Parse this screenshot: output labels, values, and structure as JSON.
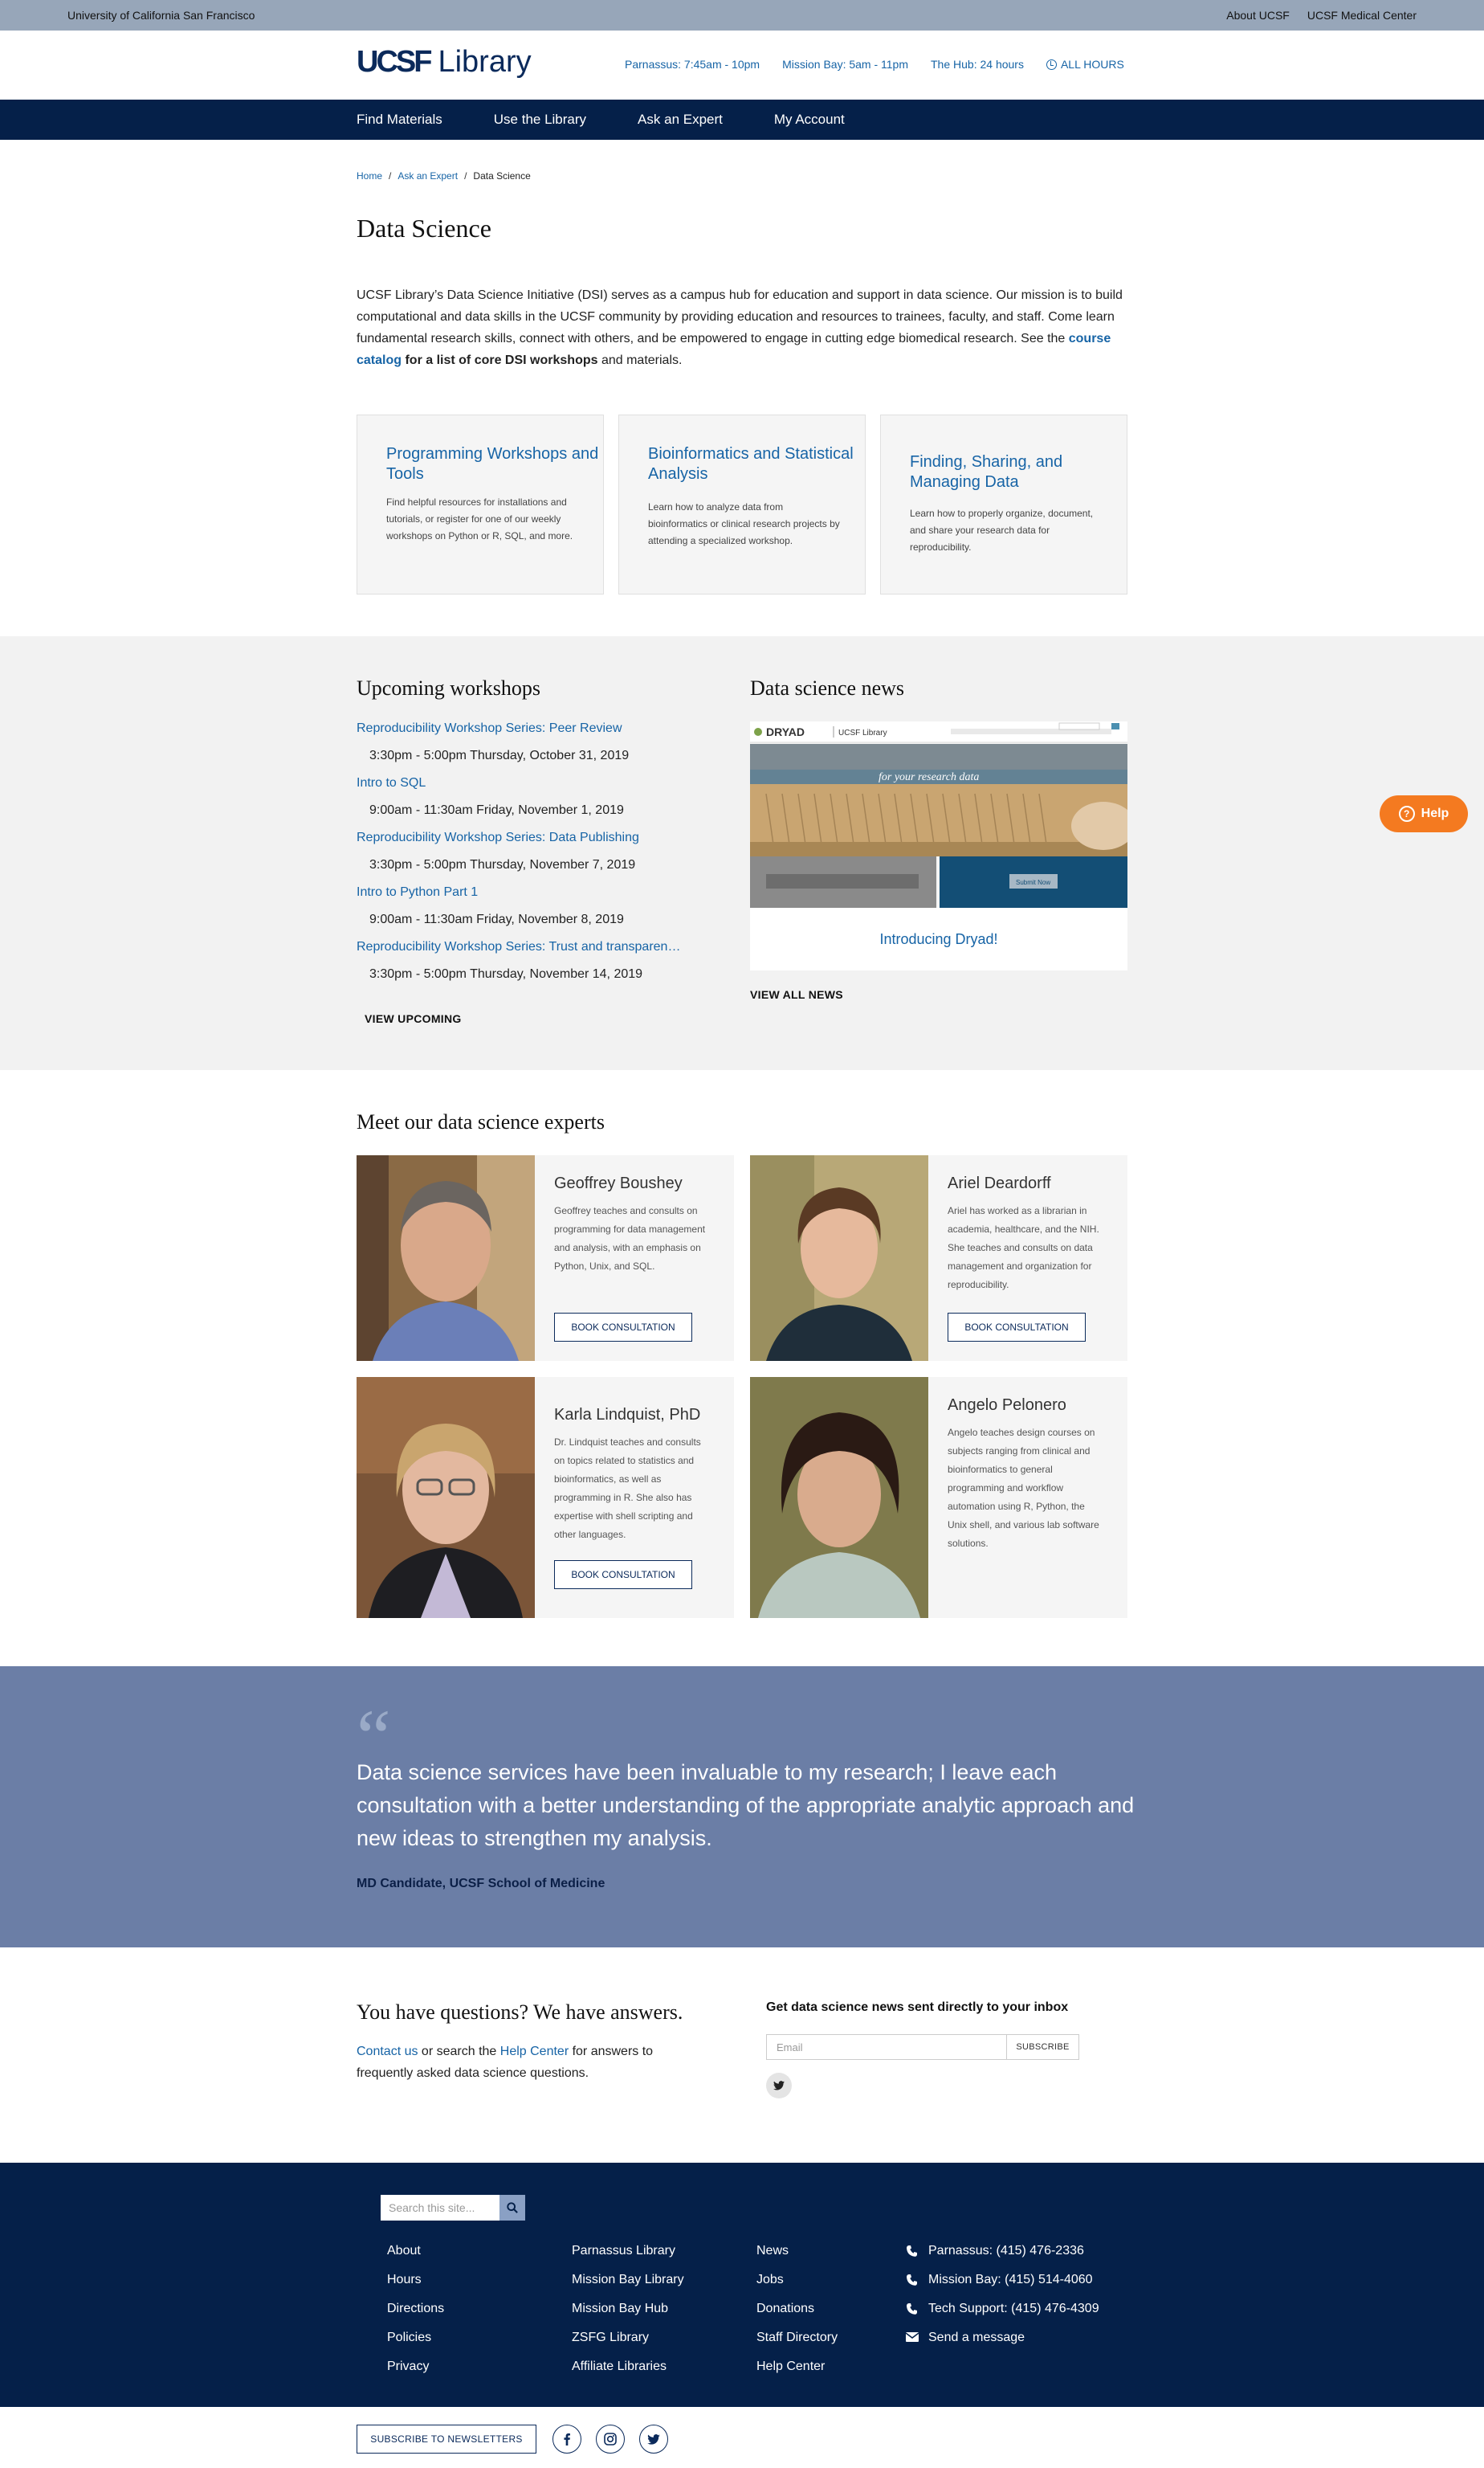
{
  "utility": {
    "org": "University of California San Francisco",
    "links": [
      "About UCSF",
      "UCSF Medical Center"
    ]
  },
  "header": {
    "logo_mark": "UCSF",
    "logo_text": "Library",
    "hours": [
      "Parnassus: 7:45am - 10pm",
      "Mission Bay: 5am - 11pm",
      "The Hub: 24 hours"
    ],
    "all_hours": "ALL HOURS"
  },
  "nav": [
    "Find Materials",
    "Use the Library",
    "Ask an Expert",
    "My Account"
  ],
  "breadcrumb": {
    "home": "Home",
    "parent": "Ask an Expert",
    "current": "Data Science"
  },
  "page_title": "Data Science",
  "intro": {
    "text": "UCSF Library’s Data Science Initiative (DSI) serves as a campus hub for education and support in data science. Our mission is to build computational and data skills in the UCSF community by providing education and resources to trainees, faculty, and staff. Come learn fundamental research skills, connect with others, and be empowered to engage in cutting edge biomedical research. See the ",
    "link": "course catalog",
    "tail": " for a list of core DSI workshops",
    "end": " and materials."
  },
  "cards": [
    {
      "title": "Programming Workshops and Tools",
      "desc": "Find helpful resources for installations and tutorials, or register for one of our weekly workshops on Python or R, SQL, and more."
    },
    {
      "title": "Bioinformatics and Statistical Analysis",
      "desc": "Learn how to analyze data from bioinformatics or clinical research projects by attending a specialized workshop."
    },
    {
      "title": "Finding, Sharing, and Managing Data",
      "desc": "Learn how to properly organize, document, and share your research data for reproducibility."
    }
  ],
  "workshops": {
    "title": "Upcoming workshops",
    "items": [
      {
        "name": "Reproducibility Workshop Series: Peer Review",
        "time": "3:30pm - 5:00pm Thursday, October 31, 2019"
      },
      {
        "name": "Intro to SQL",
        "time": "9:00am - 11:30am Friday, November 1, 2019"
      },
      {
        "name": "Reproducibility Workshop Series: Data Publishing",
        "time": "3:30pm - 5:00pm Thursday, November 7, 2019"
      },
      {
        "name": "Intro to Python Part 1",
        "time": "9:00am - 11:30am Friday, November 8, 2019"
      },
      {
        "name": "Reproducibility Workshop Series: Trust and transparen…",
        "time": "3:30pm - 5:00pm Thursday, November 14, 2019"
      }
    ],
    "view_all": "VIEW UPCOMING"
  },
  "news": {
    "title": "Data science news",
    "image": {
      "brand": "DRYAD",
      "partner": "UCSF Library",
      "banner": "for your research data",
      "submit": "Submit Now"
    },
    "caption": "Introducing Dryad!",
    "view_all": "VIEW ALL NEWS"
  },
  "help": "Help",
  "experts": {
    "title": "Meet our data science experts",
    "people": [
      {
        "name": "Geoffrey Boushey",
        "bio": "Geoffrey teaches and consults on programming for data management and analysis, with an emphasis on Python, Unix, and SQL.",
        "button": "BOOK CONSULTATION"
      },
      {
        "name": "Ariel Deardorff",
        "bio": "Ariel has worked as a librarian in academia, healthcare, and the NIH. She teaches and consults on data management and organization for reproducibility.",
        "button": "BOOK CONSULTATION"
      },
      {
        "name": "Karla Lindquist, PhD",
        "bio": "Dr. Lindquist teaches and consults on topics related to statistics and bioinformatics, as well as programming in R. She also has expertise with shell scripting and other languages.",
        "button": "BOOK CONSULTATION"
      },
      {
        "name": "Angelo Pelonero",
        "bio": "Angelo teaches design courses on subjects ranging from clinical and bioinformatics to general programming and workflow automation using R, Python, the Unix shell, and various lab software solutions."
      }
    ]
  },
  "quote": {
    "mark": "“",
    "text": "Data science services have been invaluable to my research; I leave each consultation with a better understanding of the appropriate analytic approach and new ideas to strengthen my analysis.",
    "attribution": "MD Candidate, UCSF School of Medicine"
  },
  "questions": {
    "title": "You have questions? We have answers.",
    "contact": "Contact us",
    "mid": " or search the ",
    "help_center": "Help Center",
    "end": " for answers to frequently asked data science questions."
  },
  "newsletter": {
    "title": "Get data science news sent directly to your inbox",
    "placeholder": "Email",
    "button": "SUBSCRIBE"
  },
  "footer": {
    "search_placeholder": "Search this site...",
    "col1": [
      "About",
      "Hours",
      "Directions",
      "Policies",
      "Privacy"
    ],
    "col2": [
      "Parnassus Library",
      "Mission Bay Library",
      "Mission Bay Hub",
      "ZSFG Library",
      "Affiliate Libraries"
    ],
    "col3": [
      "News",
      "Jobs",
      "Donations",
      "Staff Directory",
      "Help Center"
    ],
    "contact": [
      "Parnassus: (415) 476-2336",
      "Mission Bay: (415) 514-4060",
      "Tech Support: (415) 476-4309",
      "Send a message"
    ]
  },
  "subfooter": {
    "subscribe": "SUBSCRIBE TO NEWSLETTERS"
  },
  "colors": {
    "navy": "#052049",
    "link": "#1764a6",
    "quote_band": "#6b7ea6",
    "help": "#f47a20"
  }
}
